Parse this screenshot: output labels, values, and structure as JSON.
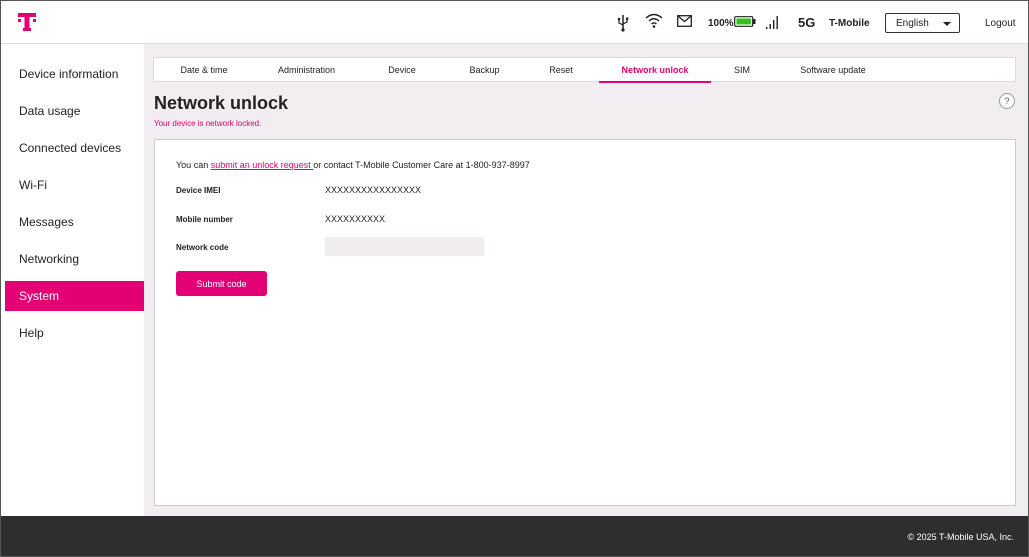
{
  "brand": {
    "accent": "#e20074",
    "footer_bg": "#2e2e2e",
    "content_bg": "#f1edf0"
  },
  "header": {
    "icons": [
      "usb-icon",
      "wifi-icon",
      "mail-icon",
      "battery-icon",
      "signal-icon"
    ],
    "battery_text": "100%",
    "battery_level": 1.0,
    "network_type": "5G",
    "carrier": "T-Mobile",
    "language": "English",
    "logout_label": "Logout"
  },
  "sidebar": {
    "items": [
      {
        "label": "Device information",
        "active": false
      },
      {
        "label": "Data usage",
        "active": false
      },
      {
        "label": "Connected devices",
        "active": false
      },
      {
        "label": "Wi-Fi",
        "active": false
      },
      {
        "label": "Messages",
        "active": false
      },
      {
        "label": "Networking",
        "active": false
      },
      {
        "label": "System",
        "active": true
      },
      {
        "label": "Help",
        "active": false
      }
    ]
  },
  "tabs": [
    {
      "label": "Date & time",
      "active": false
    },
    {
      "label": "Administration",
      "active": false
    },
    {
      "label": "Device",
      "active": false
    },
    {
      "label": "Backup",
      "active": false
    },
    {
      "label": "Reset",
      "active": false
    },
    {
      "label": "Network unlock",
      "active": true
    },
    {
      "label": "SIM",
      "active": false
    },
    {
      "label": "Software update",
      "active": false
    }
  ],
  "page": {
    "title": "Network unlock",
    "subtitle": "Your device is network locked.",
    "help_label": "?"
  },
  "form": {
    "intro_prefix": "You can ",
    "intro_link": "submit an unlock request ",
    "intro_suffix": "or contact T-Mobile Customer Care at 1-800-937-8997",
    "imei_label": "Device IMEI",
    "imei_value": "XXXXXXXXXXXXXXXX",
    "mobile_label": "Mobile number",
    "mobile_value": "XXXXXXXXXX",
    "code_label": "Network code",
    "code_value": "",
    "submit_label": "Submit code"
  },
  "footer": {
    "copyright": "© 2025 T-Mobile USA, Inc."
  }
}
